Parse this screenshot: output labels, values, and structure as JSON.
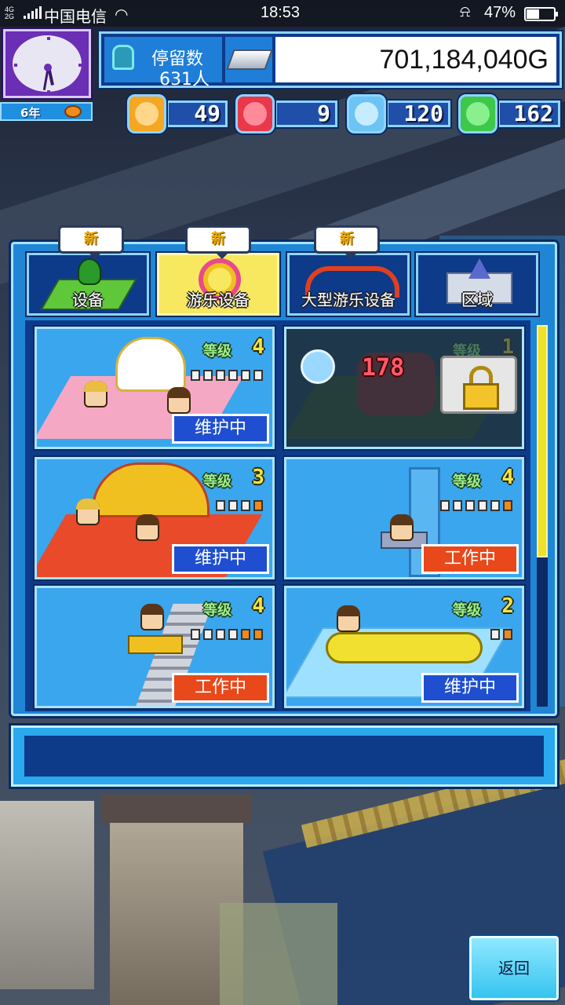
{
  "status_bar": {
    "network": "4G 2G",
    "carrier": "中国电信",
    "time": "18:53",
    "battery": "47%"
  },
  "clock": {
    "year_label": "6年"
  },
  "info": {
    "stay_label": "停留数",
    "stay_value": "631人",
    "money": "701,184,040G"
  },
  "resources": [
    {
      "name": "orange-token",
      "value": "49",
      "color": "#f5a623"
    },
    {
      "name": "fire-token",
      "value": "9",
      "color": "#e8384a"
    },
    {
      "name": "water-token",
      "value": "120",
      "color": "#6cc4f5"
    },
    {
      "name": "leaf-token",
      "value": "162",
      "color": "#3ec84a"
    }
  ],
  "badges": {
    "new": "新"
  },
  "tabs": [
    {
      "label": "设备"
    },
    {
      "label": "游乐设备"
    },
    {
      "label": "大型游乐设备"
    },
    {
      "label": "区域"
    }
  ],
  "cards": [
    {
      "level_label": "等级",
      "level": "4",
      "status": "维护中"
    },
    {
      "level_label": "等级",
      "level": "1",
      "cost": "178"
    },
    {
      "level_label": "等级",
      "level": "3",
      "status": "维护中"
    },
    {
      "level_label": "等级",
      "level": "4",
      "status": "工作中"
    },
    {
      "level_label": "等级",
      "level": "4",
      "status": "工作中"
    },
    {
      "level_label": "等级",
      "level": "2",
      "status": "维护中"
    }
  ],
  "back_button": {
    "label": "返回"
  }
}
